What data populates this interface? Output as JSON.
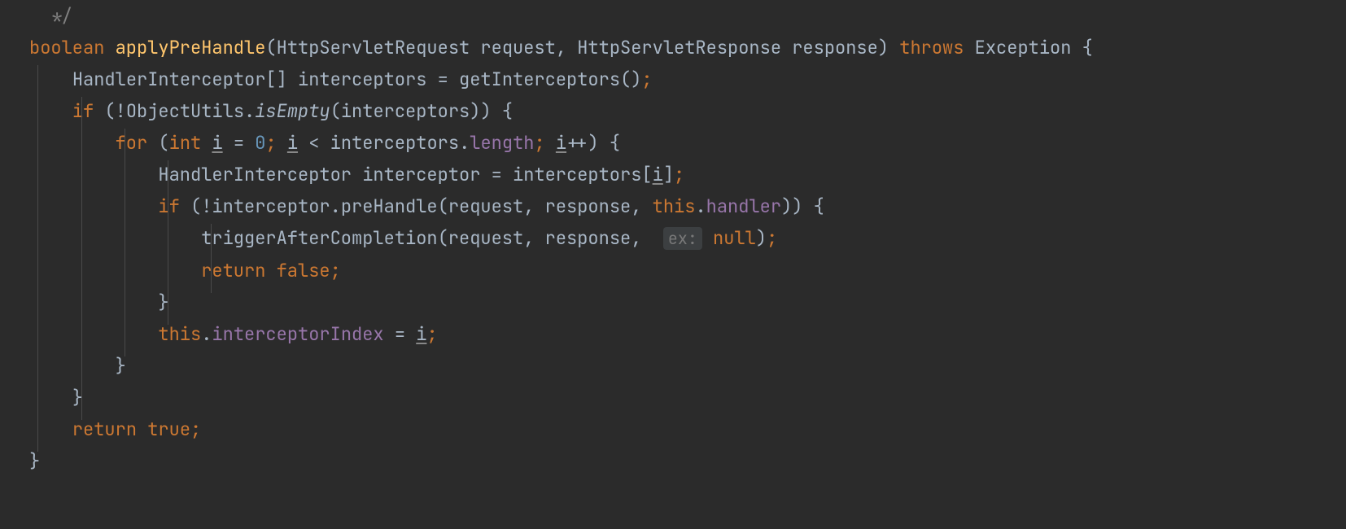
{
  "code": {
    "comment_end": "*/",
    "kw_boolean": "boolean",
    "m_applyPreHandle": "applyPreHandle",
    "p_open1": "(HttpServletRequest request",
    "p_comma1": ", ",
    "p_rest1": "HttpServletResponse response) ",
    "kw_throws": "throws",
    "p_exception": " Exception {",
    "l2a": "HandlerInterceptor[] interceptors = getInterceptors()",
    "semi": ";",
    "kw_if": "if",
    "l3a": " (!ObjectUtils.",
    "m_isEmpty": "isEmpty",
    "l3b": "(interceptors)) {",
    "kw_for": "for",
    "l4a": " (",
    "kw_int": "int",
    "sp": " ",
    "v_i": "i",
    "eq": " = ",
    "num0": "0",
    "l4b": " < interceptors.",
    "f_length": "length",
    "l4c": "++) {",
    "l5": "HandlerInterceptor interceptor = interceptors[",
    "r5": "]",
    "l6a": " (!interceptor.preHandle(request",
    "l6b": "response",
    "kw_this": "this",
    "dot": ".",
    "f_handler": "handler",
    "l6c": ")) {",
    "l7a": "triggerAfterCompletion(request",
    "hint_ex": "ex:",
    "kw_null": "null",
    "l7b": ")",
    "kw_return": "return",
    "kw_false": "false",
    "brace_close": "}",
    "f_interceptorIndex": "interceptorIndex",
    "kw_true": "true"
  }
}
